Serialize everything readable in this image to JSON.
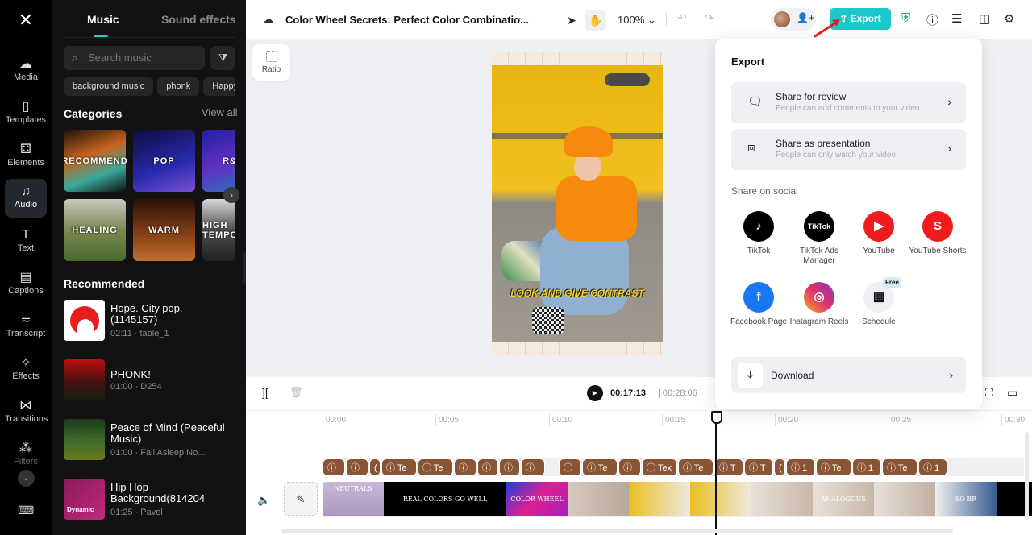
{
  "rail": {
    "items": [
      {
        "label": "Media",
        "icon": "cloud-upload-icon",
        "glyph": "☁"
      },
      {
        "label": "Templates",
        "icon": "templates-icon",
        "glyph": "▯"
      },
      {
        "label": "Elements",
        "icon": "elements-icon",
        "glyph": "⚃"
      },
      {
        "label": "Audio",
        "icon": "music-note-icon",
        "glyph": "♫"
      },
      {
        "label": "Text",
        "icon": "text-icon",
        "glyph": "T"
      },
      {
        "label": "Captions",
        "icon": "captions-icon",
        "glyph": "▤"
      },
      {
        "label": "Transcript",
        "icon": "transcript-icon",
        "glyph": "≂"
      },
      {
        "label": "Effects",
        "icon": "effects-icon",
        "glyph": "✧"
      },
      {
        "label": "Transitions",
        "icon": "transitions-icon",
        "glyph": "⋈"
      },
      {
        "label": "Filters",
        "icon": "filters-icon",
        "glyph": "⁂"
      }
    ],
    "active": "Audio"
  },
  "panel": {
    "tabs": [
      "Music",
      "Sound effects"
    ],
    "search_placeholder": "Search music",
    "chips": [
      "background music",
      "phonk",
      "Happy"
    ],
    "categories_title": "Categories",
    "view_all": "View all",
    "categories": [
      "RECOMMEND",
      "POP",
      "R&B",
      "HEALING",
      "WARM",
      "HIGH TEMPO"
    ],
    "recommended_title": "Recommended",
    "tracks": [
      {
        "title": "Hope. City pop. (1145157)",
        "meta": "02:11 · table_1"
      },
      {
        "title": "PHONK!",
        "meta": "01:00 · D254"
      },
      {
        "title": "Peace of Mind (Peaceful Music)",
        "meta": "01:00 · Fall Asleep No..."
      },
      {
        "title": "Hip Hop Background(814204",
        "meta": "01:25 · Pavel",
        "thumb_label": "Dynamic"
      }
    ]
  },
  "topbar": {
    "project_title": "Color Wheel Secrets: Perfect Color Combinatio...",
    "zoom": "100%",
    "export_label": "Export"
  },
  "canvas": {
    "ratio_label": "Ratio",
    "video_caption": "LOOK AND GIVE CONTRAST"
  },
  "export_panel": {
    "title": "Export",
    "options": [
      {
        "title": "Share for review",
        "subtitle": "People can add comments to your video."
      },
      {
        "title": "Share as presentation",
        "subtitle": "People can only watch your video."
      }
    ],
    "social_label": "Share on social",
    "social": [
      {
        "name": "TikTok",
        "color": "#000000"
      },
      {
        "name": "TikTok Ads Manager",
        "color": "#000000"
      },
      {
        "name": "YouTube",
        "color": "#ee1c1c"
      },
      {
        "name": "YouTube Shorts",
        "color": "#ee1c1c"
      },
      {
        "name": "Facebook Page",
        "color": "#1877f2"
      },
      {
        "name": "Instagram Reels",
        "color": "#d62976"
      },
      {
        "name": "Schedule",
        "color": "#eef0f3",
        "badge": "Free"
      }
    ],
    "download_label": "Download"
  },
  "player": {
    "current_time": "00:17:13",
    "total_time": "00:28:06"
  },
  "timeline": {
    "ruler": [
      "00:00",
      "00:05",
      "00:10",
      "00:15",
      "00:20",
      "00:25",
      "00:30"
    ],
    "text_clips": [
      "ⓘ",
      "ⓘ",
      "(",
      "ⓘ Te",
      "ⓘ Te",
      "ⓘ",
      "ⓘ",
      "ⓘ",
      "ⓘ",
      "ⓘ",
      "ⓘ Te",
      "ⓘ",
      "ⓘ Tex",
      "ⓘ Te",
      "ⓘ T",
      "ⓘ T",
      "(",
      "ⓘ 1",
      "ⓘ Te",
      "ⓘ 1",
      "ⓘ Te",
      "ⓘ 1"
    ],
    "video_clips": [
      "NEUTRALS",
      "REAL COLORS",
      "GO WELL TOGETHER",
      "COLOR WHEEL",
      "",
      "",
      "",
      "",
      "ANALOGOUS COLORS",
      "",
      "SO BR"
    ]
  },
  "colors": {
    "accent": "#1dc8cd",
    "text_clip": "#8a5535",
    "tab_indicator": "#2fc1d6"
  }
}
